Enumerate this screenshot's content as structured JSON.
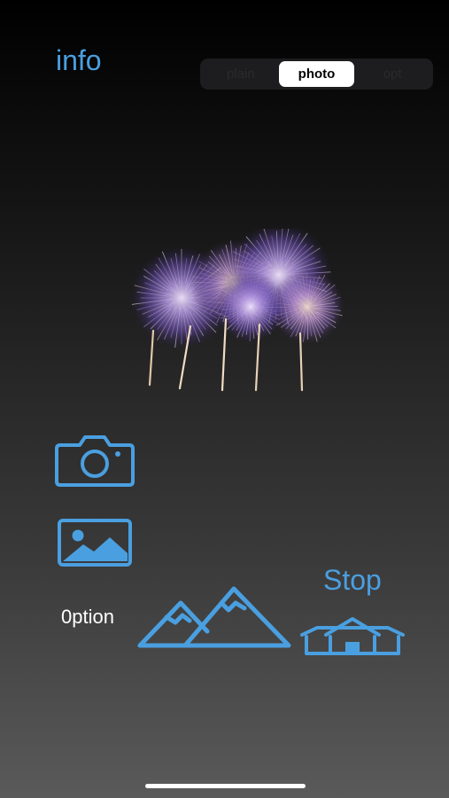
{
  "header": {
    "info_label": "info"
  },
  "segments": [
    {
      "label": "plain",
      "selected": false
    },
    {
      "label": "photo",
      "selected": true
    },
    {
      "label": "opt",
      "selected": false
    }
  ],
  "actions": {
    "option_label": "0ption",
    "stop_label": "Stop"
  },
  "icons": {
    "camera": "camera-icon",
    "gallery": "photo-icon",
    "mountains": "mountains-icon",
    "home": "house-icon"
  },
  "colors": {
    "accent": "#4a9fe0",
    "background_top": "#000000",
    "background_bottom": "#5a5a5a",
    "segment_selected": "#ffffff"
  }
}
